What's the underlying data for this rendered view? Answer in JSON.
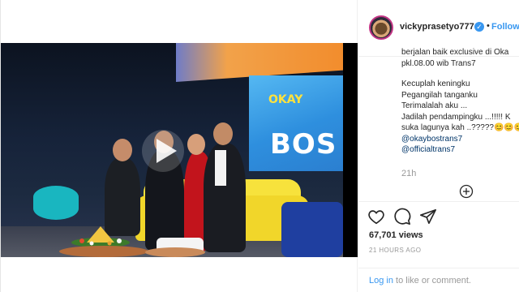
{
  "header": {
    "username": "vickyprasetyo777",
    "dot": "•",
    "follow_label": "Follow"
  },
  "caption": {
    "lines": [
      "berjalan baik exclusive di Oka",
      "pkl.08.00 wib Trans7",
      "",
      "Kecuplah keningku",
      "Pegangilah tanganku",
      "Terimalalah aku ...",
      "Jadilah pendampingku ...!!!!! K",
      "suka lagunya kah ..?????😊😊😊",
      "@okaybostrans7",
      "@officialtrans7"
    ]
  },
  "age": "21h",
  "stats": {
    "views": "67,701 views",
    "time_ago": "21 HOURS AGO"
  },
  "login": {
    "link": "Log in",
    "rest": " to like or comment."
  },
  "video": {
    "show_title_small": "OKAY",
    "show_title_big": "BOS"
  },
  "colors": {
    "link_blue": "#3897f0",
    "verified_blue": "#3897f0",
    "text_dark": "#262626",
    "muted": "#999999"
  },
  "icons": [
    "verified-badge-icon",
    "play-icon",
    "add-comment-icon",
    "heart-icon",
    "comment-icon",
    "share-icon"
  ]
}
